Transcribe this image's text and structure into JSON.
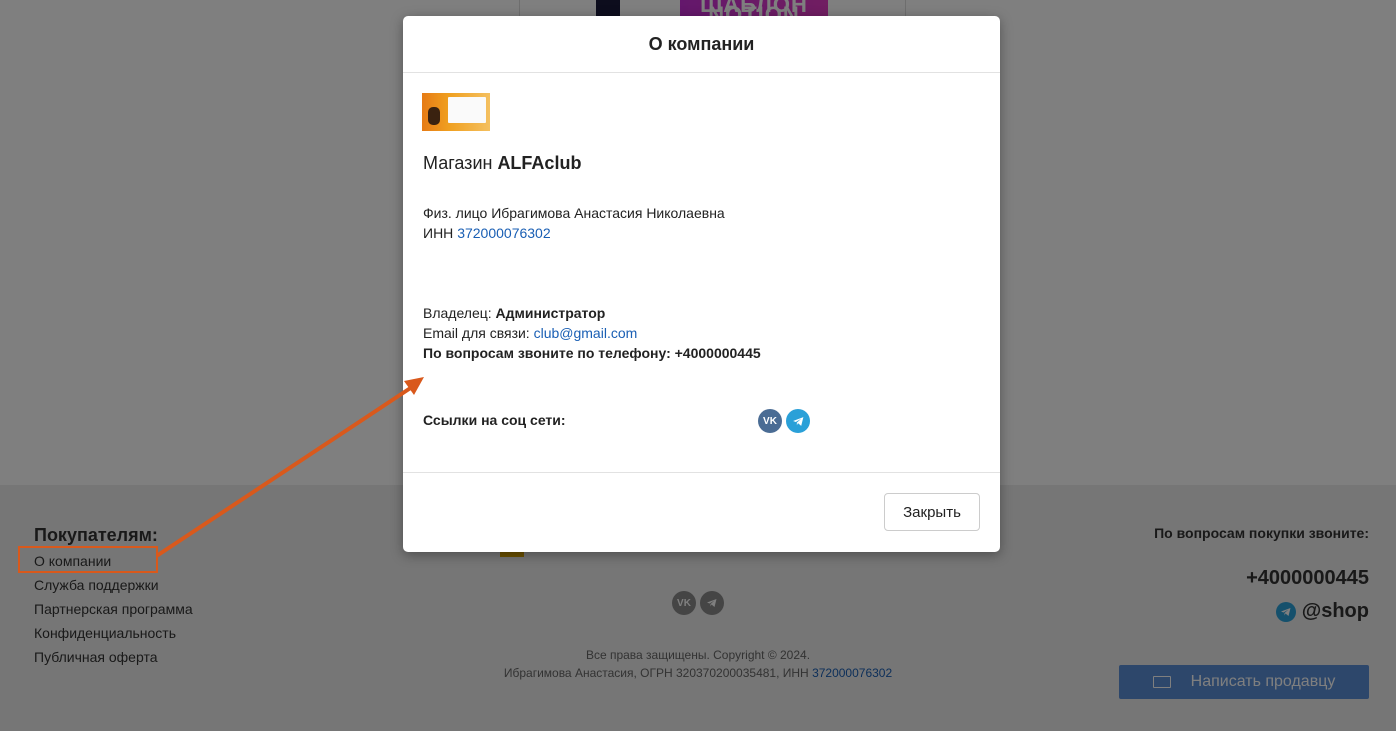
{
  "background": {
    "top_image_text": "ШАБЛОН NOTION",
    "footer": {
      "buyers_title": "Покупателям:",
      "links": [
        "О компании",
        "Служба поддержки",
        "Партнерская программа",
        "Конфиденциальность",
        "Публичная оферта"
      ],
      "social_icons": [
        "vk-icon",
        "telegram-icon"
      ],
      "copyright_line1": "Все права защищены. Copyright © 2024.",
      "copyright_line2_prefix": "Ибрагимова Анастасия, ОГРН 320370200035481, ИНН ",
      "copyright_inn": "372000076302",
      "right_title": "По вопросам покупки звоните:",
      "right_phone": "+4000000445",
      "right_telegram": "@shop",
      "write_seller_label": "Написать продавцу"
    }
  },
  "modal": {
    "title": "О компании",
    "shop_prefix": "Магазин ",
    "shop_name": "ALFAclub",
    "person": "Физ. лицо Ибрагимова Анастасия Николаевна",
    "inn_label": "ИНН ",
    "inn_value": "372000076302",
    "owner_label": "Владелец: ",
    "owner_value": "Администратор",
    "email_label": "Email для связи: ",
    "email_value": "club@gmail.com",
    "phone_line": "По вопросам звоните по телефону: +4000000445",
    "social_label": "Ссылки на соц сети:",
    "social_icons": [
      "vk-icon",
      "telegram-icon"
    ],
    "close_label": "Закрыть"
  },
  "colors": {
    "annotation": "#d9591c",
    "link": "#1a5fb4",
    "vk": "#4a6c94",
    "telegram": "#2aa0d8",
    "write_button": "#5b8fd6"
  }
}
